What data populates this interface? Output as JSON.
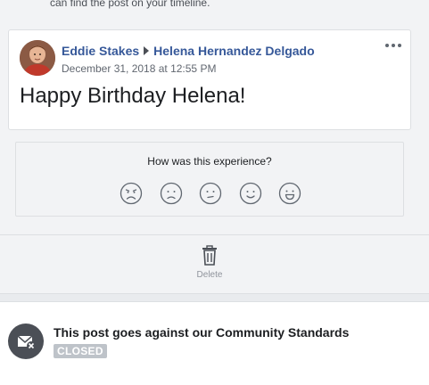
{
  "header_text": "can find the post on your timeline.",
  "post": {
    "author": "Eddie Stakes",
    "recipient": "Helena Hernandez Delgado",
    "date": "December 31, 2018 at 12:55 PM",
    "body": "Happy Birthday Helena!",
    "more_icon": "more-options-icon"
  },
  "survey": {
    "question": "How was this experience?",
    "options": [
      "very-dissatisfied-face",
      "dissatisfied-face",
      "neutral-face",
      "satisfied-face",
      "very-satisfied-face"
    ]
  },
  "actions": {
    "delete_label": "Delete",
    "delete_icon": "trash-icon"
  },
  "notice": {
    "title": "This post goes against our Community Standards",
    "status": "CLOSED",
    "icon": "flagged-envelope-icon"
  },
  "colors": {
    "link": "#365899",
    "notice_icon_bg": "#4b4f56",
    "badge_bg": "#bec3c9",
    "page_bg": "#f2f3f5"
  }
}
